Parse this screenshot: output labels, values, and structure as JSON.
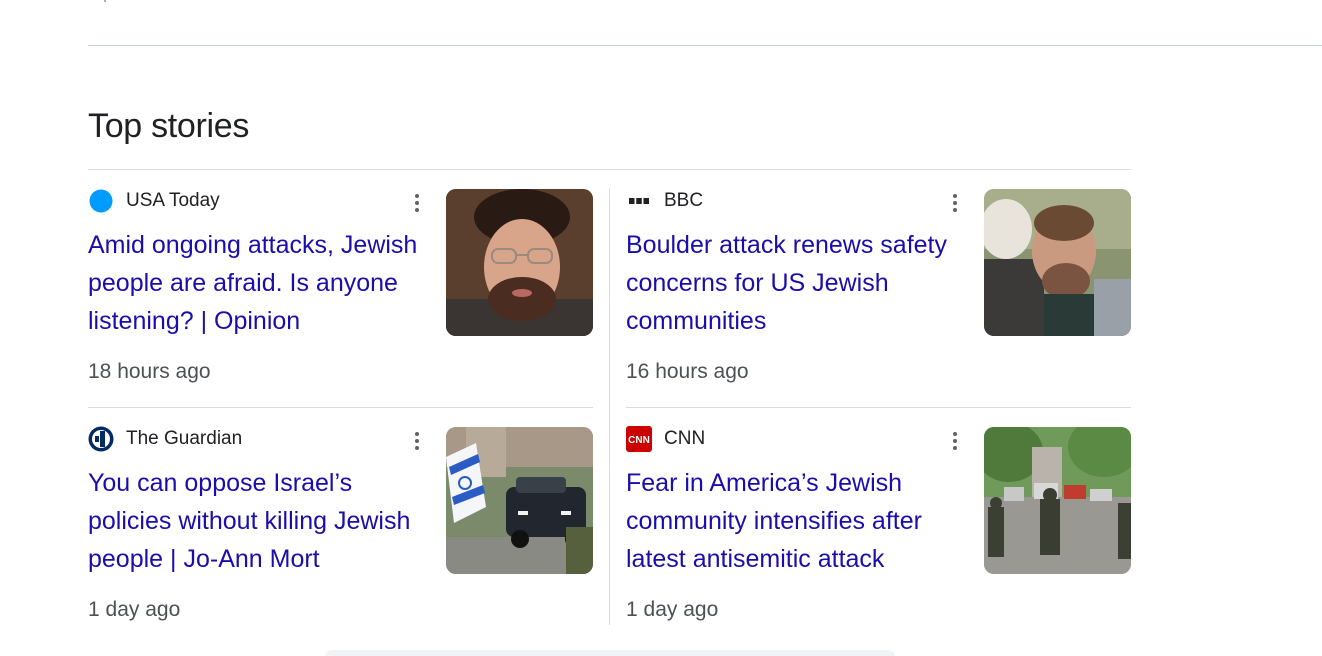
{
  "section": {
    "title": "Top stories"
  },
  "stories": [
    {
      "source": "USA Today",
      "source_icon": "usa-today-logo-icon",
      "headline": "Amid ongoing attacks, Jewish people are afraid. Is anyone listening? | Opinion",
      "time": "18 hours ago",
      "thumbnail": "portrait-photo-man-glasses"
    },
    {
      "source": "BBC",
      "source_icon": "bbc-logo-icon",
      "headline": "Boulder attack renews safety concerns for US Jewish communities",
      "time": "16 hours ago",
      "thumbnail": "photo-man-embracing"
    },
    {
      "source": "The Guardian",
      "source_icon": "guardian-logo-icon",
      "headline": "You can oppose Israel’s policies without killing Jewish people | Jo-Ann Mort",
      "time": "1 day ago",
      "thumbnail": "photo-israeli-flag-police-car"
    },
    {
      "source": "CNN",
      "source_icon": "cnn-logo-icon",
      "headline": "Fear in America’s Jewish community intensifies after latest antisemitic attack",
      "time": "1 day ago",
      "thumbnail": "photo-police-on-street"
    }
  ],
  "colors": {
    "headline": "#1a0dab",
    "meta": "#4d5156",
    "divider": "#dadce0",
    "usa_today_blue": "#009bff",
    "cnn_red": "#cc0000"
  }
}
